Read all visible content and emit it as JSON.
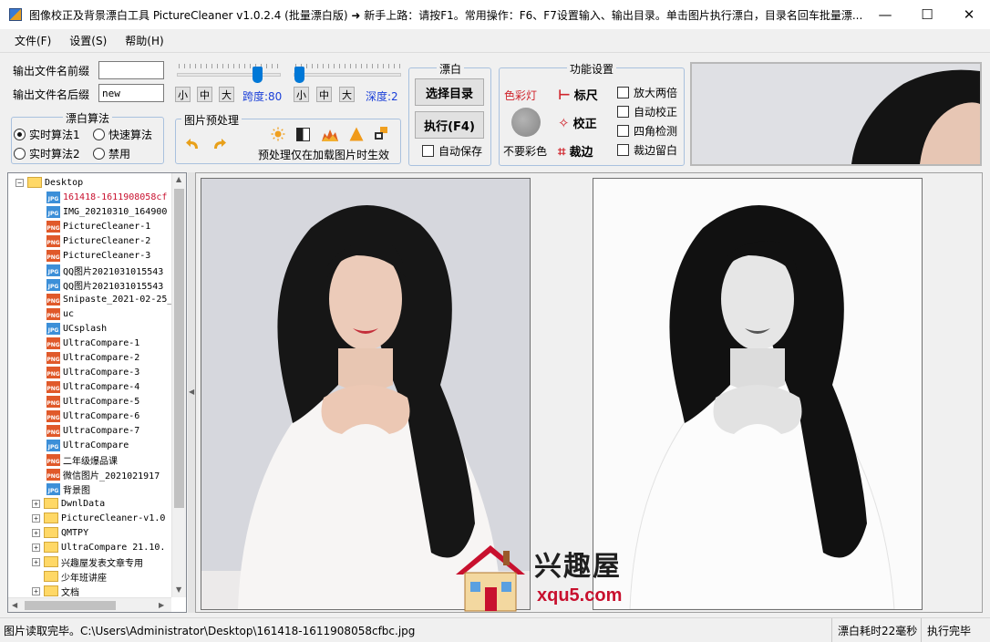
{
  "window": {
    "title": "图像校正及背景漂白工具 PictureCleaner v1.0.2.4  (批量漂白版)    ➜ 新手上路：请按F1。常用操作：F6、F7设置输入、输出目录。单击图片执行漂白，目录名回车批量漂...",
    "minimize": "—",
    "maximize": "☐",
    "close": "✕"
  },
  "menu": [
    "文件(F)",
    "设置(S)",
    "帮助(H)"
  ],
  "output": {
    "prefix_label": "输出文件名前缀",
    "prefix_value": "",
    "suffix_label": "输出文件名后缀",
    "suffix_value": "new"
  },
  "sliders": {
    "small": "小",
    "medium": "中",
    "large": "大",
    "span_label": "跨度:80",
    "depth_label": "深度:2",
    "span_value": 80,
    "depth_value": 2
  },
  "algo": {
    "title": "漂白算法",
    "options": [
      {
        "label": "实时算法1",
        "selected": true
      },
      {
        "label": "快速算法",
        "selected": false
      },
      {
        "label": "实时算法2",
        "selected": false
      },
      {
        "label": "禁用",
        "selected": false
      }
    ]
  },
  "preprocess": {
    "title": "图片预处理",
    "note": "预处理仅在加载图片时生效",
    "icons": [
      "undo-icon",
      "redo-icon",
      "brightness-icon",
      "contrast-icon",
      "levels-icon",
      "sharpen-icon",
      "crop-tool-icon"
    ]
  },
  "bleach": {
    "title": "漂白",
    "select_dir": "选择目录",
    "execute": "执行(F4)",
    "autosave": "自动保存"
  },
  "functions": {
    "title": "功能设置",
    "color_light": "色彩灯",
    "no_color": "不要彩色",
    "ruler": "标尺",
    "correct": "校正",
    "crop": "裁边",
    "checks": [
      "放大两倍",
      "自动校正",
      "四角检测",
      "裁边留白"
    ]
  },
  "tree": [
    {
      "label": "Desktop",
      "type": "folder",
      "level": 0,
      "expander": "−"
    },
    {
      "label": "161418-1611908058cf",
      "type": "jpg",
      "level": 1,
      "selected": true
    },
    {
      "label": "IMG_20210310_164900",
      "type": "jpg",
      "level": 1
    },
    {
      "label": "PictureCleaner-1",
      "type": "png",
      "level": 1
    },
    {
      "label": "PictureCleaner-2",
      "type": "png",
      "level": 1
    },
    {
      "label": "PictureCleaner-3",
      "type": "png",
      "level": 1
    },
    {
      "label": "QQ图片2021031015543",
      "type": "jpg",
      "level": 1
    },
    {
      "label": "QQ图片2021031015543",
      "type": "jpg",
      "level": 1
    },
    {
      "label": "Snipaste_2021-02-25_",
      "type": "png",
      "level": 1
    },
    {
      "label": "uc",
      "type": "png",
      "level": 1
    },
    {
      "label": "UCsplash",
      "type": "jpg",
      "level": 1
    },
    {
      "label": "UltraCompare-1",
      "type": "png",
      "level": 1
    },
    {
      "label": "UltraCompare-2",
      "type": "png",
      "level": 1
    },
    {
      "label": "UltraCompare-3",
      "type": "png",
      "level": 1
    },
    {
      "label": "UltraCompare-4",
      "type": "png",
      "level": 1
    },
    {
      "label": "UltraCompare-5",
      "type": "png",
      "level": 1
    },
    {
      "label": "UltraCompare-6",
      "type": "png",
      "level": 1
    },
    {
      "label": "UltraCompare-7",
      "type": "png",
      "level": 1
    },
    {
      "label": "UltraCompare",
      "type": "jpg",
      "level": 1
    },
    {
      "label": "二年级爆品课",
      "type": "png",
      "level": 1
    },
    {
      "label": "微信图片_2021021917",
      "type": "png",
      "level": 1
    },
    {
      "label": "背景图",
      "type": "jpg",
      "level": 1
    },
    {
      "label": "DwnlData",
      "type": "folder",
      "level": 1,
      "expander": "+"
    },
    {
      "label": "PictureCleaner-v1.0",
      "type": "folder",
      "level": 1,
      "expander": "+"
    },
    {
      "label": "QMTPY",
      "type": "folder",
      "level": 1,
      "expander": "+"
    },
    {
      "label": "UltraCompare 21.10.",
      "type": "folder",
      "level": 1,
      "expander": "+"
    },
    {
      "label": "兴趣屋发表文章专用",
      "type": "folder",
      "level": 1,
      "expander": "+"
    },
    {
      "label": "少年班讲座",
      "type": "folder",
      "level": 1,
      "expander": ""
    },
    {
      "label": "文档",
      "type": "folder",
      "level": 1,
      "expander": "+"
    }
  ],
  "watermark": {
    "cn": "兴趣屋",
    "url": "xqu5.com"
  },
  "status": {
    "main": "图片读取完毕。C:\\Users\\Administrator\\Desktop\\161418-1611908058cfbc.jpg",
    "time": "漂白耗时22毫秒",
    "done": "执行完毕"
  },
  "colors": {
    "accent": "#0078d7",
    "group_border": "#a9c1de",
    "func_red": "#d0242c",
    "label_blue": "#1a3fd8"
  }
}
